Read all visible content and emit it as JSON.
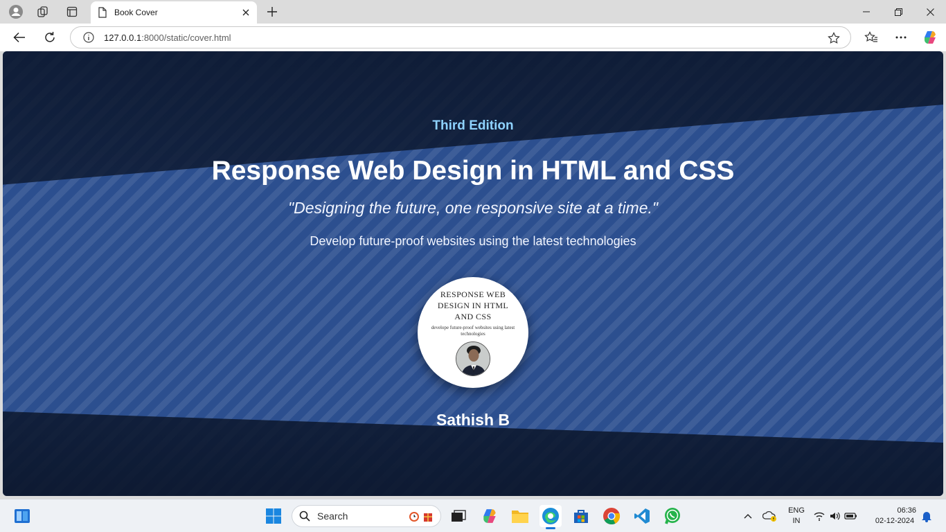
{
  "browser": {
    "tab_title": "Book Cover",
    "url_host": "127.0.0.1",
    "url_rest": ":8000/static/cover.html"
  },
  "cover": {
    "edition": "Third Edition",
    "title": "Response Web Design in HTML and CSS",
    "quote": "\"Designing the future, one responsive site at a time.\"",
    "description": "Develop future-proof websites using the latest technologies",
    "badge_title": "RESPONSE WEB DESIGN IN HTML AND CSS",
    "badge_subtitle": "develope future-proof websites using latest technologies",
    "author": "Sathish B"
  },
  "taskbar": {
    "search_label": "Search",
    "language_line1": "ENG",
    "language_line2": "IN",
    "time": "06:36",
    "date": "02-12-2024"
  },
  "colors": {
    "page_blue": "#2c4f8f",
    "edition_cyan": "#8fd3ff",
    "dark_navy": "#0a1428"
  }
}
